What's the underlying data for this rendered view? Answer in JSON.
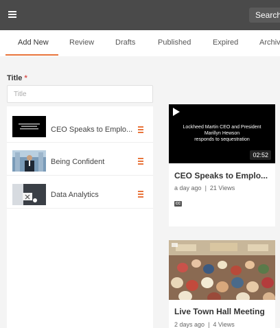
{
  "header": {
    "menu_icon": "hamburger-icon",
    "search_label": "Search i"
  },
  "tabs": [
    {
      "label": "Add New",
      "active": true
    },
    {
      "label": "Review"
    },
    {
      "label": "Drafts"
    },
    {
      "label": "Published"
    },
    {
      "label": "Expired"
    },
    {
      "label": "Archiv"
    }
  ],
  "form": {
    "title_label": "Title",
    "required_mark": "*",
    "title_placeholder": "Title"
  },
  "playlist": [
    {
      "title": "CEO Speaks to Emplo...",
      "thumb_icon": "video-thumbnail"
    },
    {
      "title": "Being Confident",
      "thumb_icon": "video-thumbnail"
    },
    {
      "title": "Data Analytics",
      "thumb_icon": "video-thumbnail"
    }
  ],
  "cards": [
    {
      "thumb_caption": "Lockheed Martin CEO and President\nMarillyn Hewson\nresponds to sequestration",
      "duration": "02:52",
      "title": "CEO Speaks to Emplo...",
      "age": "a day ago",
      "separator": "|",
      "views": "21 Views",
      "cc": "CC"
    },
    {
      "title": "Live Town Hall Meeting",
      "age": "2 days ago",
      "separator": "|",
      "views": "4 Views"
    }
  ],
  "colors": {
    "accent": "#e8743b",
    "topbar": "#4a4a4a"
  }
}
